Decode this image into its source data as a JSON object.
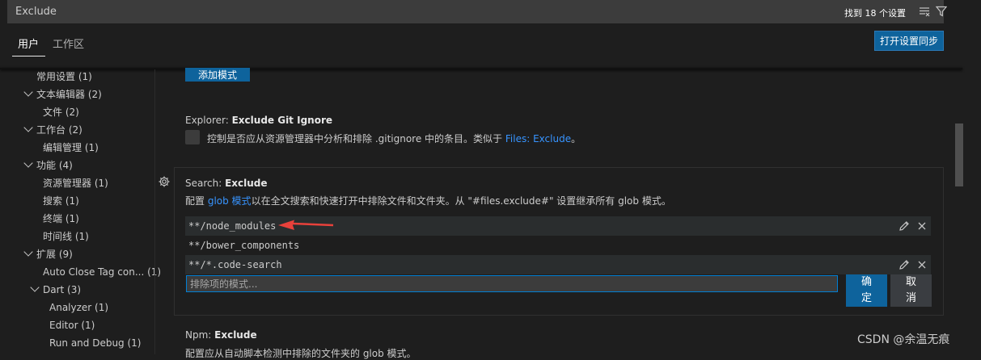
{
  "search": {
    "value": "Exclude",
    "result_count": "找到 18 个设置"
  },
  "tabs": {
    "user": "用户",
    "workspace": "工作区",
    "sync_button": "打开设置同步"
  },
  "toc": [
    {
      "label": "常用设置 (1)"
    },
    {
      "label": "文本编辑器 (2)"
    },
    {
      "label": "文件 (2)"
    },
    {
      "label": "工作台 (2)"
    },
    {
      "label": "编辑管理 (1)"
    },
    {
      "label": "功能 (4)"
    },
    {
      "label": "资源管理器 (1)"
    },
    {
      "label": "搜索 (1)"
    },
    {
      "label": "终端 (1)"
    },
    {
      "label": "时间线 (1)"
    },
    {
      "label": "扩展 (9)"
    },
    {
      "label": "Auto Close Tag con... (1)"
    },
    {
      "label": "Dart (3)"
    },
    {
      "label": "Analyzer (1)"
    },
    {
      "label": "Editor (1)"
    },
    {
      "label": "Run and Debug (1)"
    }
  ],
  "add_pattern_button": "添加模式",
  "explorer_setting": {
    "category": "Explorer: ",
    "name": "Exclude Git Ignore",
    "desc": "控制是否应从资源管理器中分析和排除 .gitignore 中的条目。类似于 ",
    "link": "Files: Exclude",
    "desc_end": "。"
  },
  "search_setting": {
    "category": "Search: ",
    "name": "Exclude",
    "desc_pre": "配置 ",
    "link": "glob 模式",
    "desc_post": "以在全文搜索和快速打开中排除文件和文件夹。从 \"#files.exclude#\" 设置继承所有 glob 模式。",
    "items": [
      "**/node_modules",
      "**/bower_components",
      "**/*.code-search"
    ],
    "input_placeholder": "排除项的模式...",
    "ok_label": "确定",
    "cancel_label": "取消"
  },
  "npm_setting": {
    "category": "Npm: ",
    "name": "Exclude",
    "desc": "配置应从自动脚本检测中排除的文件夹的 glob 模式。"
  },
  "watermark": "CSDN @余温无痕",
  "colors": {
    "accent": "#0e639c",
    "link": "#3794ff",
    "arrow": "#e8413b"
  }
}
